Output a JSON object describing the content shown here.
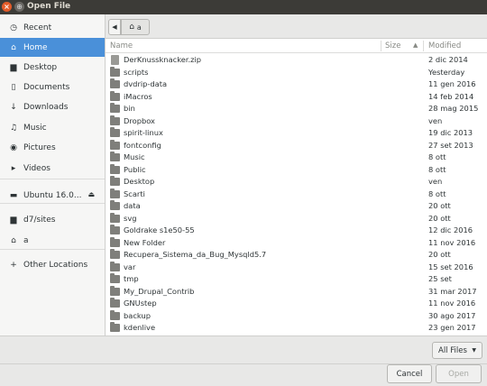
{
  "window": {
    "title": "Open File",
    "close_glyph": "×",
    "grip_glyph": "⊕"
  },
  "sidebar": {
    "items": [
      {
        "label": "Recent",
        "icon": "clock-icon",
        "glyph": "◷"
      },
      {
        "label": "Home",
        "icon": "home-icon",
        "glyph": "⌂",
        "active": true
      },
      {
        "label": "Desktop",
        "icon": "folder-icon",
        "glyph": "▆"
      },
      {
        "label": "Documents",
        "icon": "document-icon",
        "glyph": "▯"
      },
      {
        "label": "Downloads",
        "icon": "download-icon",
        "glyph": "↓"
      },
      {
        "label": "Music",
        "icon": "music-icon",
        "glyph": "♫"
      },
      {
        "label": "Pictures",
        "icon": "camera-icon",
        "glyph": "◉"
      },
      {
        "label": "Videos",
        "icon": "video-icon",
        "glyph": "▸"
      },
      {
        "label": "Ubuntu 16.0...",
        "icon": "drive-icon",
        "glyph": "▬",
        "eject": "⏏"
      },
      {
        "label": "d7/sites",
        "icon": "folder-icon",
        "glyph": "▆"
      },
      {
        "label": "a",
        "icon": "home-icon",
        "glyph": "⌂"
      },
      {
        "label": "Other Locations",
        "icon": "plus-icon",
        "glyph": "+"
      }
    ]
  },
  "breadcrumb": {
    "back_glyph": "◀",
    "home_glyph": "⌂",
    "home_label": "a"
  },
  "columns": {
    "name": "Name",
    "size": "Size",
    "modified": "Modified",
    "sort_glyph": "▲"
  },
  "files": [
    {
      "name": "DerKnussknacker.zip",
      "modified": "2 dic 2014",
      "type": "file"
    },
    {
      "name": "scripts",
      "modified": "Yesterday",
      "type": "folder"
    },
    {
      "name": "dvdrip-data",
      "modified": "11 gen 2016",
      "type": "folder"
    },
    {
      "name": "iMacros",
      "modified": "14 feb 2014",
      "type": "folder"
    },
    {
      "name": "bin",
      "modified": "28 mag 2015",
      "type": "folder"
    },
    {
      "name": "Dropbox",
      "modified": "ven",
      "type": "folder"
    },
    {
      "name": "spirit-linux",
      "modified": "19 dic 2013",
      "type": "folder"
    },
    {
      "name": "fontconfig",
      "modified": "27 set 2013",
      "type": "folder"
    },
    {
      "name": "Music",
      "modified": "8 ott",
      "type": "folder"
    },
    {
      "name": "Public",
      "modified": "8 ott",
      "type": "folder"
    },
    {
      "name": "Desktop",
      "modified": "ven",
      "type": "folder"
    },
    {
      "name": "Scarti",
      "modified": "8 ott",
      "type": "folder"
    },
    {
      "name": "data",
      "modified": "20 ott",
      "type": "folder"
    },
    {
      "name": "svg",
      "modified": "20 ott",
      "type": "folder"
    },
    {
      "name": "Goldrake s1e50-55",
      "modified": "12 dic 2016",
      "type": "folder"
    },
    {
      "name": "New Folder",
      "modified": "11 nov 2016",
      "type": "folder"
    },
    {
      "name": "Recupera_Sistema_da_Bug_Mysqld5.7",
      "modified": "20 ott",
      "type": "folder"
    },
    {
      "name": "var",
      "modified": "15 set 2016",
      "type": "folder"
    },
    {
      "name": "tmp",
      "modified": "25 set",
      "type": "folder"
    },
    {
      "name": "My_Drupal_Contrib",
      "modified": "31 mar 2017",
      "type": "folder"
    },
    {
      "name": "GNUstep",
      "modified": "11 nov 2016",
      "type": "folder"
    },
    {
      "name": "backup",
      "modified": "30 ago 2017",
      "type": "folder"
    },
    {
      "name": "kdenlive",
      "modified": "23 gen 2017",
      "type": "folder"
    }
  ],
  "footer": {
    "filter_label": "All Files",
    "filter_caret": "▼",
    "cancel_label": "Cancel",
    "open_label": "Open"
  },
  "colors": {
    "accent": "#4a90d9",
    "titlebar": "#3c3b37",
    "close": "#e45c2a"
  }
}
